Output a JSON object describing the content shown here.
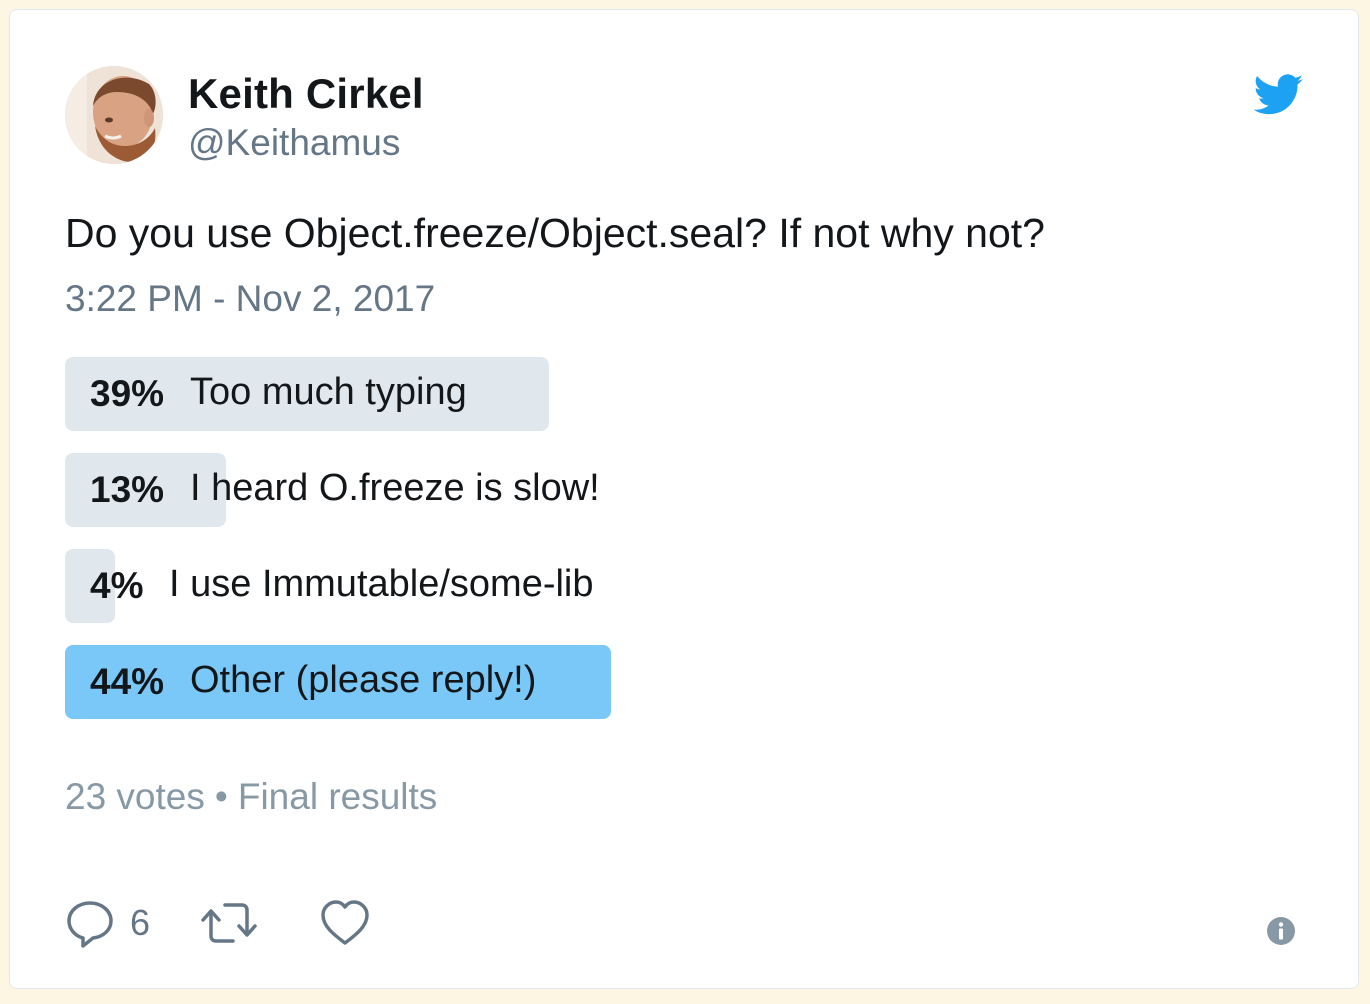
{
  "author": {
    "name": "Keith Cirkel",
    "handle": "@Keithamus"
  },
  "tweet": {
    "text": "Do you use Object.freeze/Object.seal? If not why not?",
    "timestamp": "3:22 PM - Nov 2, 2017"
  },
  "poll": {
    "options": [
      {
        "percent": "39%",
        "value": 0.39,
        "label": "Too much typing",
        "winner": false
      },
      {
        "percent": "13%",
        "value": 0.13,
        "label": "I heard O.freeze is slow!",
        "winner": false
      },
      {
        "percent": "4%",
        "value": 0.04,
        "label": "I use Immutable/some-lib",
        "winner": false
      },
      {
        "percent": "44%",
        "value": 0.44,
        "label": "Other (please reply!)",
        "winner": true
      }
    ],
    "votes": "23 votes",
    "separator": "•",
    "status": "Final results"
  },
  "actions": {
    "reply_count": "6"
  },
  "icons": {
    "logo": "twitter-bird-icon",
    "reply": "reply-icon",
    "retweet": "retweet-icon",
    "like": "heart-icon",
    "info": "info-icon"
  },
  "colors": {
    "brand": "#1da1f2",
    "poll_bar": "#e1e8ed",
    "poll_winner": "#7ac8f7",
    "text": "#14171a",
    "muted": "#657786",
    "background": "#fdf6e3"
  }
}
